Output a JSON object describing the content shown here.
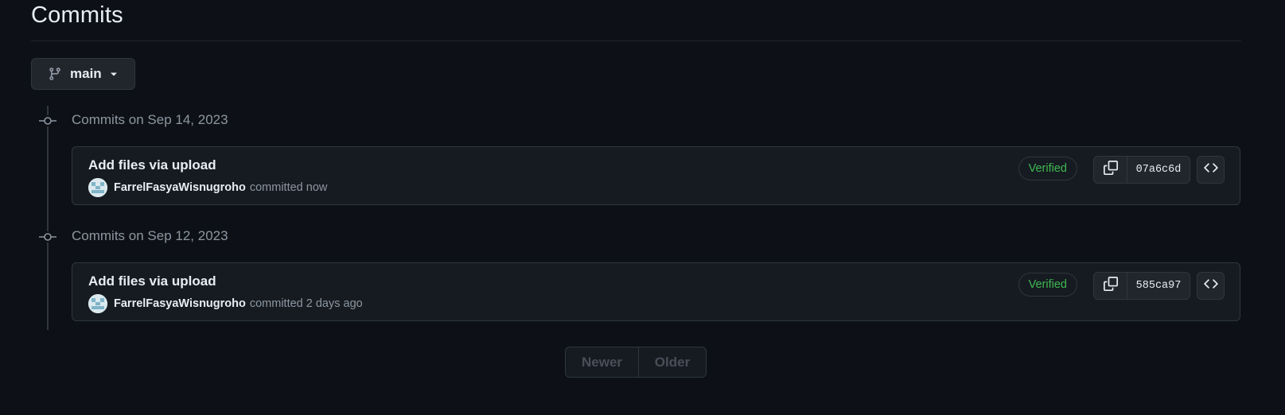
{
  "page": {
    "title": "Commits"
  },
  "branch": {
    "name": "main",
    "icon": "git-branch-icon"
  },
  "commit_groups": [
    {
      "heading": "Commits on Sep 14, 2023",
      "commits": [
        {
          "message": "Add files via upload",
          "author": "FarrelFasyaWisnugroho",
          "committed_text": "committed now",
          "verified_label": "Verified",
          "sha": "07a6c6d"
        }
      ]
    },
    {
      "heading": "Commits on Sep 12, 2023",
      "commits": [
        {
          "message": "Add files via upload",
          "author": "FarrelFasyaWisnugroho",
          "committed_text": "committed 2 days ago",
          "verified_label": "Verified",
          "sha": "585ca97"
        }
      ]
    }
  ],
  "pagination": {
    "newer_label": "Newer",
    "older_label": "Older",
    "newer_enabled": false,
    "older_enabled": false
  },
  "colors": {
    "background": "#0d1117",
    "verified": "#3fb950",
    "muted_text": "#8d96a0",
    "border": "#30363d"
  },
  "icons": {
    "timeline_node": "git-commit-icon",
    "copy": "copy-icon",
    "browse": "code-icon",
    "dropdown": "caret-down-icon"
  }
}
